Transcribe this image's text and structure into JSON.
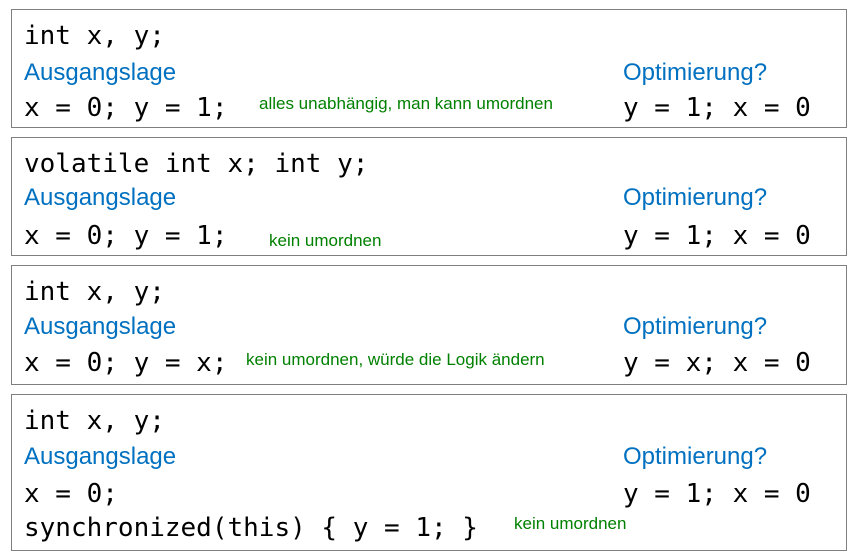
{
  "panels": [
    {
      "declaration": "int x, y;",
      "left_heading": "Ausgangslage",
      "right_heading": "Optimierung?",
      "original_code": "x = 0; y = 1;",
      "comment": "alles unabhängig, man kann umordnen",
      "optimized_code": "y = 1; x = 0"
    },
    {
      "declaration": "volatile int x; int y;",
      "left_heading": "Ausgangslage",
      "right_heading": "Optimierung?",
      "original_code": "x = 0; y = 1;",
      "comment": "kein umordnen",
      "optimized_code": "y = 1; x = 0"
    },
    {
      "declaration": "int x, y;",
      "left_heading": "Ausgangslage",
      "right_heading": "Optimierung?",
      "original_code": "x = 0; y = x;",
      "comment": "kein umordnen, würde die Logik ändern",
      "optimized_code": "y = x; x = 0"
    },
    {
      "declaration": "int x, y;",
      "left_heading": "Ausgangslage",
      "right_heading": "Optimierung?",
      "original_code": "x = 0;",
      "optimized_code": "y = 1; x = 0",
      "sync_code": "synchronized(this) { y = 1; }",
      "comment": "kein umordnen"
    }
  ]
}
